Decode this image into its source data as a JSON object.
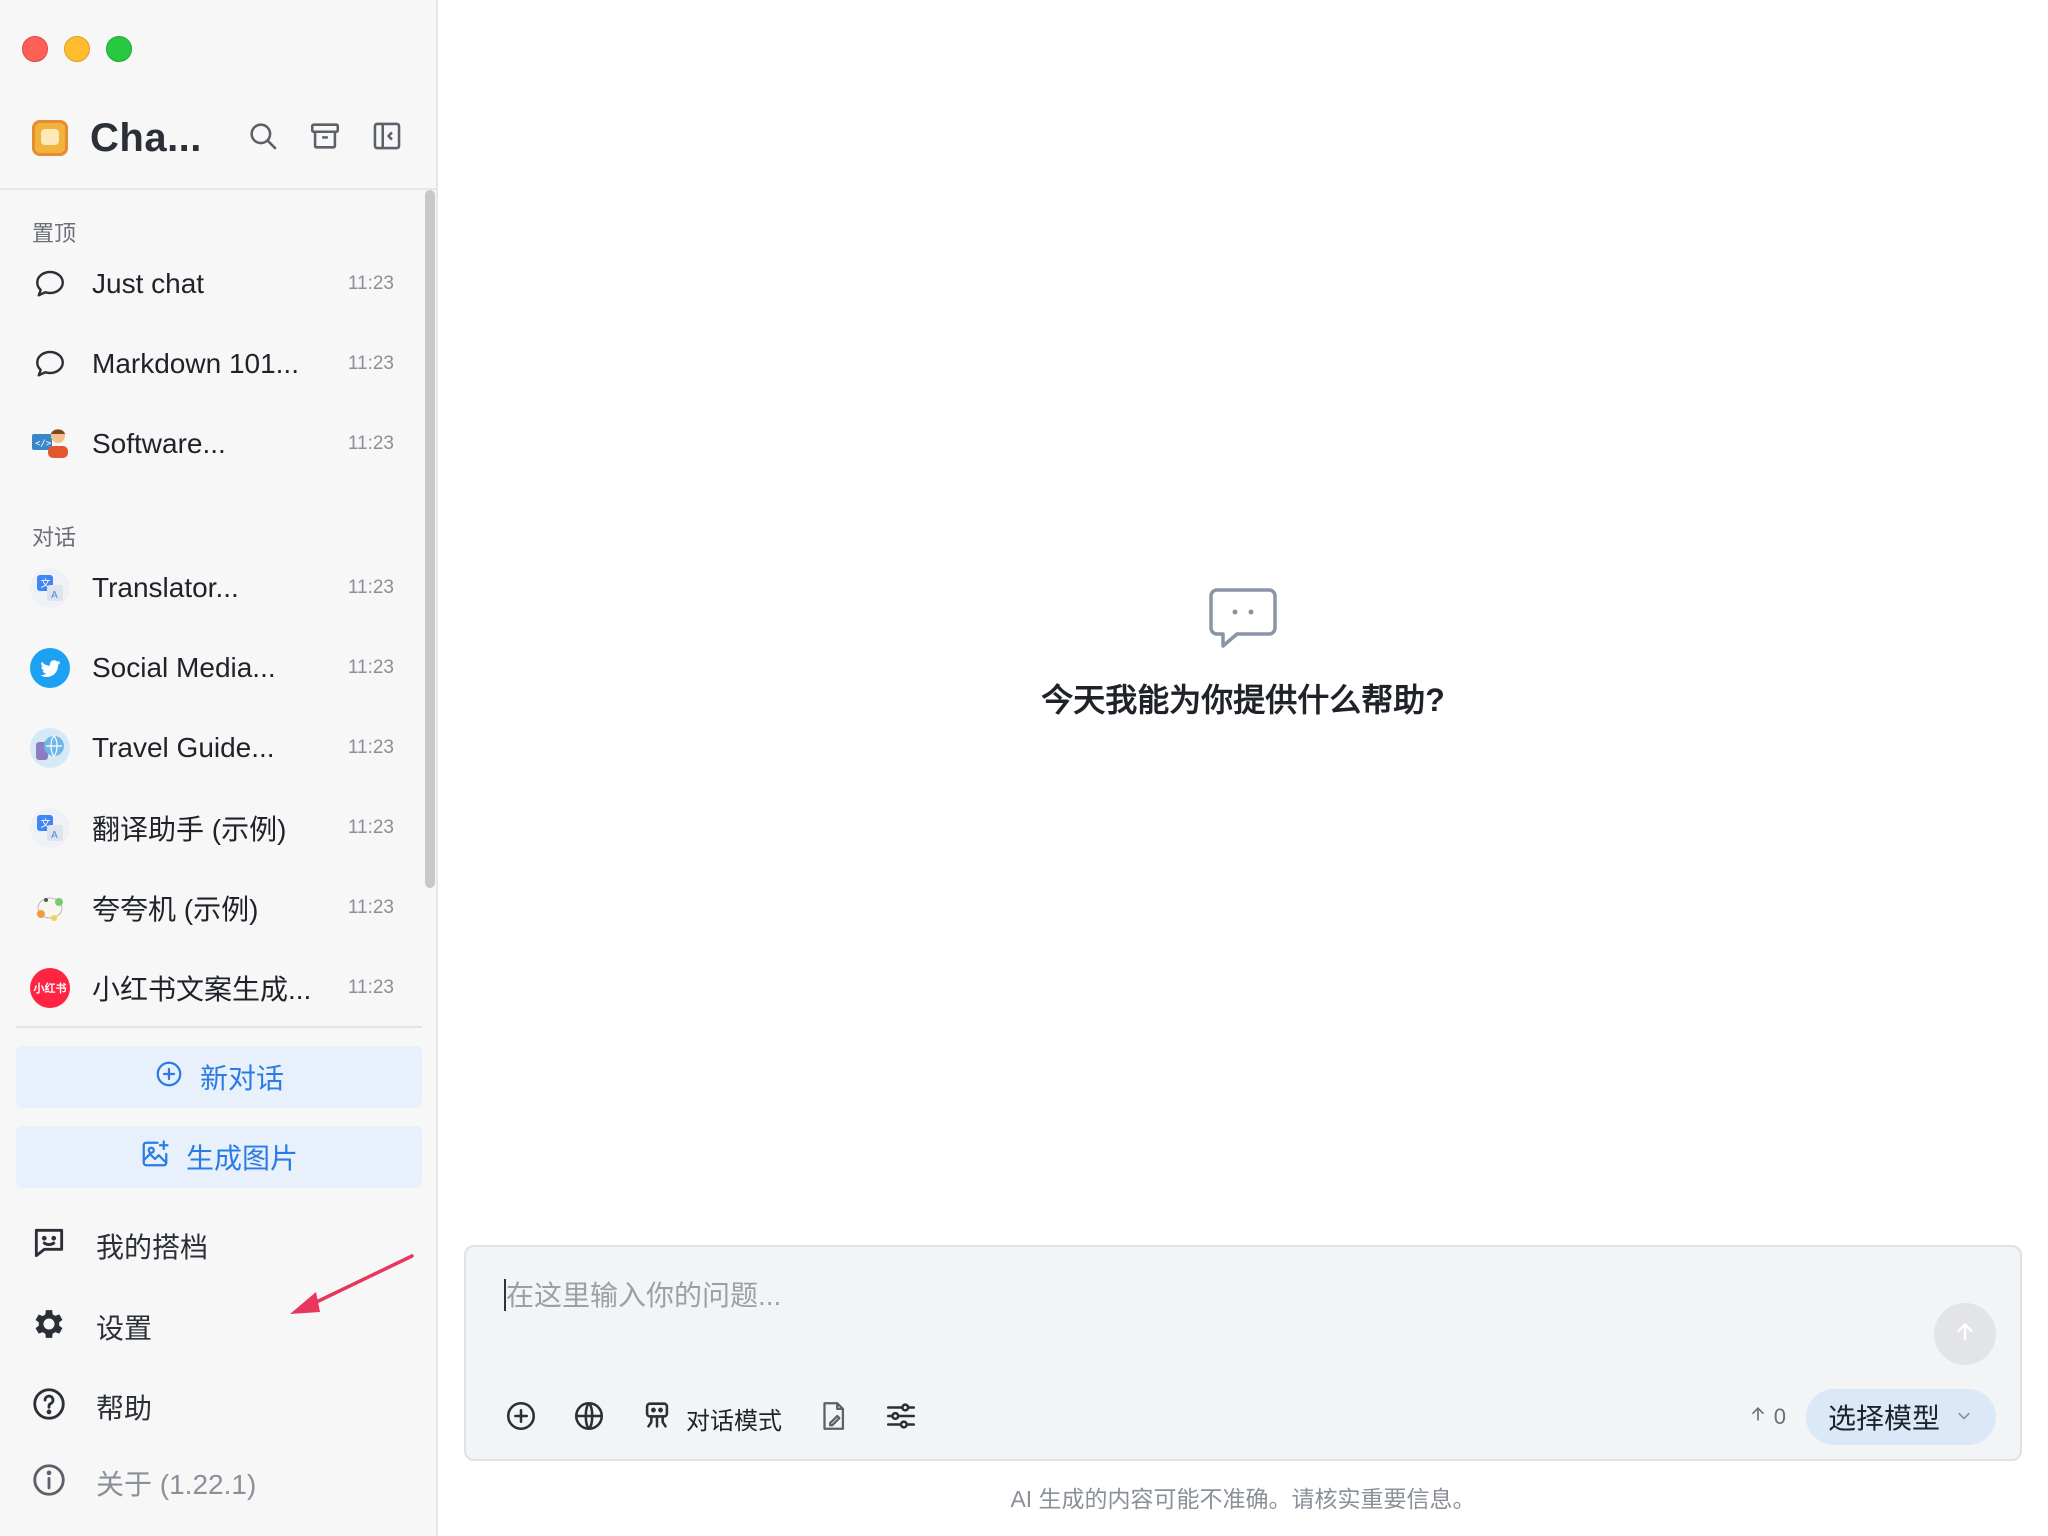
{
  "app": {
    "title": "Cha..."
  },
  "sidebar": {
    "pinned_label": "置顶",
    "pinned": [
      {
        "title": "Just chat",
        "time": "11:23",
        "icon": "chat-bubble-icon"
      },
      {
        "title": "Markdown 101...",
        "time": "11:23",
        "icon": "chat-bubble-icon"
      },
      {
        "title": "Software...",
        "time": "11:23",
        "icon": "software-developer-avatar-icon"
      }
    ],
    "chats_label": "对话",
    "chats": [
      {
        "title": "Translator...",
        "time": "11:23",
        "icon": "translator-icon"
      },
      {
        "title": "Social Media...",
        "time": "11:23",
        "icon": "twitter-bird-icon"
      },
      {
        "title": "Travel Guide...",
        "time": "11:23",
        "icon": "travel-globe-icon"
      },
      {
        "title": "翻译助手 (示例)",
        "time": "11:23",
        "icon": "translator-icon"
      },
      {
        "title": "夸夸机 (示例)",
        "time": "11:23",
        "icon": "flower-pot-icon"
      },
      {
        "title": "小红书文案生成...",
        "time": "11:23",
        "icon": "xiaohongshu-logo-icon"
      }
    ],
    "new_chat_label": "新对话",
    "generate_image_label": "生成图片",
    "my_partners_label": "我的搭档",
    "settings_label": "设置",
    "help_label": "帮助",
    "about_label": "关于 (1.22.1)",
    "xiaohongshu_logo_text": "小红书"
  },
  "main": {
    "empty_title": "今天我能为你提供什么帮助?",
    "input_placeholder": "在这里输入你的问题...",
    "mode_label": "对话模式",
    "token_count": "0",
    "model_button_label": "选择模型",
    "disclaimer": "AI 生成的内容可能不准确。请核实重要信息。"
  },
  "colors": {
    "accent": "#2c7be5",
    "arrow": "#e8365d",
    "twitter": "#1da1f2",
    "xiaohongshu": "#ff2442"
  }
}
